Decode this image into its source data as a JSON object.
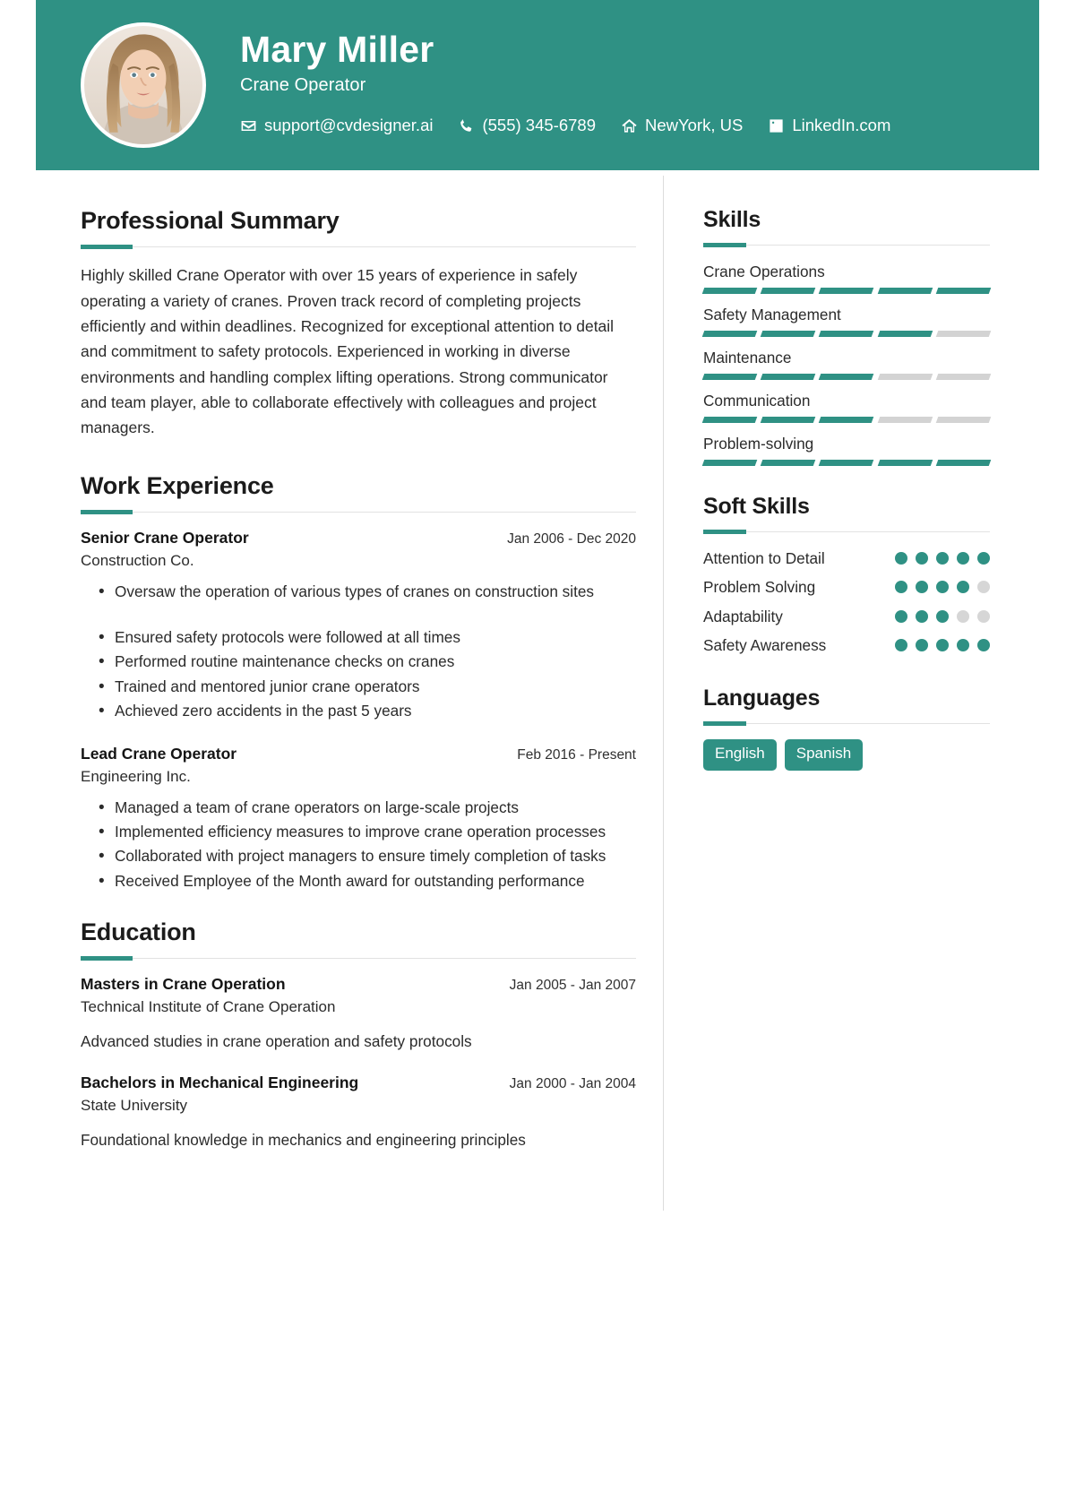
{
  "theme": {
    "accent": "#2f9184",
    "track": "#d3d3d3",
    "rule": "#e2e2e2",
    "text": "#2b2b2b"
  },
  "header": {
    "name": "Mary Miller",
    "job_title": "Crane Operator",
    "avatar_alt": "profile-photo",
    "contacts": [
      {
        "icon": "envelope-icon",
        "text": "support@cvdesigner.ai"
      },
      {
        "icon": "phone-icon",
        "text": "(555) 345-6789"
      },
      {
        "icon": "home-icon",
        "text": "NewYork, US"
      },
      {
        "icon": "linkedin-icon",
        "text": "LinkedIn.com"
      }
    ]
  },
  "summary": {
    "title": "Professional Summary",
    "text": "Highly skilled Crane Operator with over 15 years of experience in safely operating a variety of cranes. Proven track record of completing projects efficiently and within deadlines. Recognized for exceptional attention to detail and commitment to safety protocols. Experienced in working in diverse environments and handling complex lifting operations. Strong communicator and team player, able to collaborate effectively with colleagues and project managers."
  },
  "experience": {
    "title": "Work Experience",
    "items": [
      {
        "role": "Senior Crane Operator",
        "dates": "Jan 2006 - Dec 2020",
        "org": "Construction Co.",
        "bullets": [
          "Oversaw the operation of various types of cranes on construction sites",
          "Ensured safety protocols were followed at all times",
          "Performed routine maintenance checks on cranes",
          "Trained and mentored junior crane operators",
          "Achieved zero accidents in the past 5 years"
        ]
      },
      {
        "role": "Lead Crane Operator",
        "dates": "Feb 2016 - Present",
        "org": "Engineering Inc.",
        "bullets": [
          "Managed a team of crane operators on large-scale projects",
          "Implemented efficiency measures to improve crane operation processes",
          "Collaborated with project managers to ensure timely completion of tasks",
          "Received Employee of the Month award for outstanding performance"
        ]
      }
    ]
  },
  "education": {
    "title": "Education",
    "items": [
      {
        "degree": "Masters in Crane Operation",
        "dates": "Jan 2005 - Jan 2007",
        "school": "Technical Institute of Crane Operation",
        "note": "Advanced studies in crane operation and safety protocols"
      },
      {
        "degree": "Bachelors in Mechanical Engineering",
        "dates": "Jan 2000 - Jan 2004",
        "school": "State University",
        "note": "Foundational knowledge in mechanics and engineering principles"
      }
    ]
  },
  "skills": {
    "title": "Skills",
    "segments_total": 5,
    "items": [
      {
        "name": "Crane Operations",
        "filled": 5
      },
      {
        "name": "Safety Management",
        "filled": 4
      },
      {
        "name": "Maintenance",
        "filled": 3
      },
      {
        "name": "Communication",
        "filled": 3
      },
      {
        "name": "Problem-solving",
        "filled": 5
      }
    ]
  },
  "soft_skills": {
    "title": "Soft Skills",
    "dots_total": 5,
    "items": [
      {
        "name": "Attention to Detail",
        "filled": 5
      },
      {
        "name": "Problem Solving",
        "filled": 4
      },
      {
        "name": "Adaptability",
        "filled": 3
      },
      {
        "name": "Safety Awareness",
        "filled": 5
      }
    ]
  },
  "languages": {
    "title": "Languages",
    "items": [
      "English",
      "Spanish"
    ]
  }
}
